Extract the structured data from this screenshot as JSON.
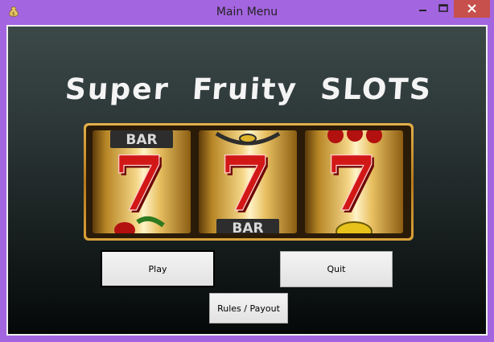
{
  "window": {
    "title": "Main Menu",
    "app_icon": "money-bag-icon",
    "controls": [
      "minimize-icon",
      "maximize-icon",
      "close-icon"
    ],
    "close_color": "#c7504c",
    "frame_color": "#a465e0"
  },
  "game": {
    "title": "Super Fruity SLOTS",
    "reels": [
      {
        "top": "BAR",
        "center": "7",
        "bottom": "cherries"
      },
      {
        "top": "watermelon",
        "center": "7",
        "bottom": "BAR"
      },
      {
        "top": "cherries",
        "center": "7",
        "bottom": "lemon"
      }
    ],
    "reel_label_bar": "BAR",
    "seven_symbol": "7"
  },
  "buttons": {
    "play": "Play",
    "quit": "Quit",
    "rules": "Rules / Payout"
  }
}
